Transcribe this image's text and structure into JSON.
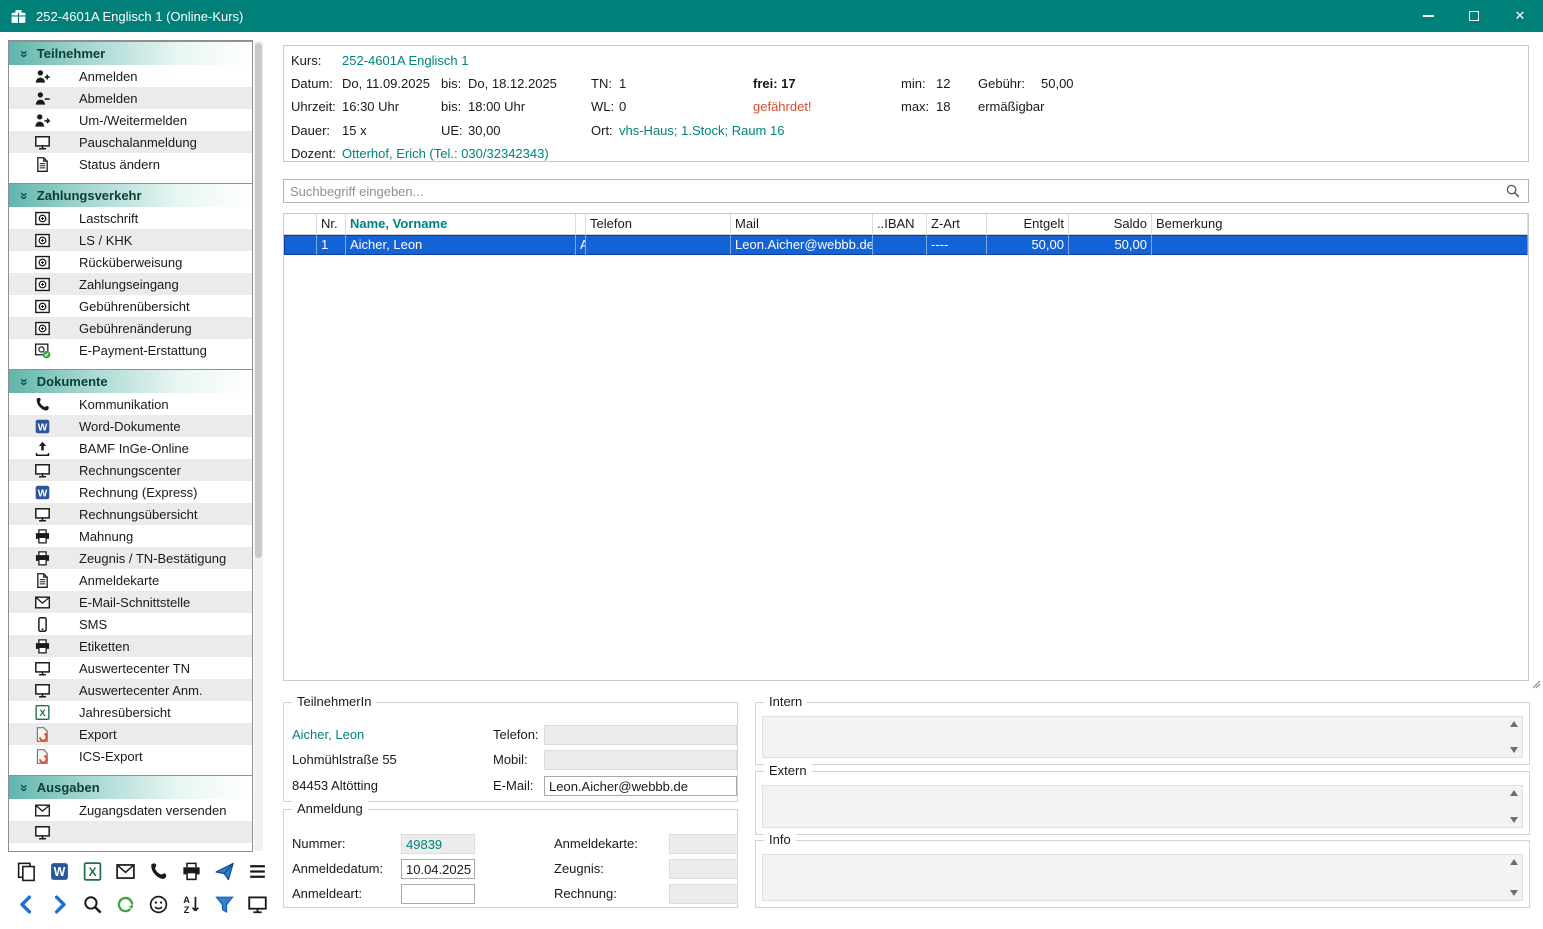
{
  "window": {
    "title": "252-4601A Englisch 1 (Online-Kurs)"
  },
  "colors": {
    "titlebar": "#008079",
    "accent": "#00837c",
    "selection": "#1463d6",
    "danger": "#d94a2a"
  },
  "search": {
    "placeholder": "Suchbegriff eingeben..."
  },
  "sidebar": {
    "sections": [
      {
        "title": "Teilnehmer",
        "items": [
          {
            "label": "Anmelden",
            "icon": "person-add"
          },
          {
            "label": "Abmelden",
            "icon": "person-remove"
          },
          {
            "label": "Um-/Weitermelden",
            "icon": "person-forward"
          },
          {
            "label": "Pauschalanmeldung",
            "icon": "monitor"
          },
          {
            "label": "Status ändern",
            "icon": "document"
          }
        ]
      },
      {
        "title": "Zahlungsverkehr",
        "items": [
          {
            "label": "Lastschrift",
            "icon": "coin"
          },
          {
            "label": "LS / KHK",
            "icon": "coin"
          },
          {
            "label": "Rücküberweisung",
            "icon": "coin"
          },
          {
            "label": "Zahlungseingang",
            "icon": "coin"
          },
          {
            "label": "Gebührenübersicht",
            "icon": "coin"
          },
          {
            "label": "Gebührenänderung",
            "icon": "coin"
          },
          {
            "label": "E-Payment-Erstattung",
            "icon": "epayment"
          }
        ]
      },
      {
        "title": "Dokumente",
        "items": [
          {
            "label": "Kommunikation",
            "icon": "phone"
          },
          {
            "label": "Word-Dokumente",
            "icon": "word"
          },
          {
            "label": "BAMF InGe-Online",
            "icon": "upload"
          },
          {
            "label": "Rechnungscenter",
            "icon": "monitor"
          },
          {
            "label": "Rechnung (Express)",
            "icon": "word"
          },
          {
            "label": "Rechnungsübersicht",
            "icon": "monitor"
          },
          {
            "label": "Mahnung",
            "icon": "print"
          },
          {
            "label": "Zeugnis / TN-Bestätigung",
            "icon": "print"
          },
          {
            "label": "Anmeldekarte",
            "icon": "document"
          },
          {
            "label": "E-Mail-Schnittstelle",
            "icon": "mail"
          },
          {
            "label": "SMS",
            "icon": "mobile"
          },
          {
            "label": "Etiketten",
            "icon": "print"
          },
          {
            "label": "Auswertecenter TN",
            "icon": "monitor"
          },
          {
            "label": "Auswertecenter Anm.",
            "icon": "monitor"
          },
          {
            "label": "Jahresübersicht",
            "icon": "excel"
          },
          {
            "label": "Export",
            "icon": "export"
          },
          {
            "label": "ICS-Export",
            "icon": "export"
          }
        ]
      },
      {
        "title": "Ausgaben",
        "items": [
          {
            "label": "Zugangsdaten versenden",
            "icon": "mail"
          },
          {
            "label": "",
            "icon": "monitor"
          }
        ]
      }
    ]
  },
  "toolbar": {
    "row1": [
      "copy",
      "word",
      "excel",
      "mail",
      "phone",
      "print",
      "send",
      "menu"
    ],
    "row2": [
      "back",
      "forward",
      "zoom",
      "refresh",
      "smiley",
      "sort",
      "filter",
      "monitor"
    ]
  },
  "course": {
    "kurs_label": "Kurs:",
    "kurs": "252-4601A Englisch 1",
    "datum_label": "Datum:",
    "datum": "Do, 11.09.2025",
    "bis1_label": "bis:",
    "datum_bis": "Do, 18.12.2025",
    "tn_label": "TN:",
    "tn": "1",
    "frei_text": "frei: 17",
    "min_label": "min:",
    "min": "12",
    "gebuehr_label": "Gebühr:",
    "gebuehr": "50,00",
    "uhrzeit_label": "Uhrzeit:",
    "uhrzeit": "16:30 Uhr",
    "bis2_label": "bis:",
    "uhrzeit_bis": "18:00 Uhr",
    "wl_label": "WL:",
    "wl": "0",
    "gefaehrdet": "gefährdet!",
    "max_label": "max:",
    "max": "18",
    "ermaessigbar": "ermäßigbar",
    "dauer_label": "Dauer:",
    "dauer": "15 x",
    "ue_label": "UE:",
    "ue": "30,00",
    "ort_label": "Ort:",
    "ort": "vhs-Haus; 1.Stock; Raum 16",
    "dozent_label": "Dozent:",
    "dozent": "Otterhof, Erich (Tel.: 030/32342343)"
  },
  "table": {
    "columns": [
      "",
      "Nr.",
      "Name, Vorname",
      "",
      "Telefon",
      "Mail",
      "..IBAN",
      "Z-Art",
      "Entgelt",
      "Saldo",
      "Bemerkung"
    ],
    "rows": [
      {
        "nr": "1",
        "name": "Aicher, Leon",
        "flag": "A",
        "telefon": "",
        "mail": "Leon.Aicher@webbb.de",
        "iban": "",
        "zart": "----",
        "entgelt": "50,00",
        "saldo": "50,00",
        "bemerkung": ""
      }
    ]
  },
  "teilnehmer_panel": {
    "legend": "TeilnehmerIn",
    "name": "Aicher, Leon",
    "street": "Lohmühlstraße 55",
    "city": "84453 Altötting",
    "telefon_label": "Telefon:",
    "telefon": "",
    "mobil_label": "Mobil:",
    "mobil": "",
    "email_label": "E-Mail:",
    "email": "Leon.Aicher@webbb.de"
  },
  "anmeldung_panel": {
    "legend": "Anmeldung",
    "nummer_label": "Nummer:",
    "nummer": "49839",
    "datum_label": "Anmeldedatum:",
    "datum": "10.04.2025",
    "art_label": "Anmeldeart:",
    "art": "",
    "karte_label": "Anmeldekarte:",
    "karte": "",
    "zeugnis_label": "Zeugnis:",
    "zeugnis": "",
    "rechnung_label": "Rechnung:",
    "rechnung": ""
  },
  "notes": {
    "intern_legend": "Intern",
    "extern_legend": "Extern",
    "info_legend": "Info"
  }
}
